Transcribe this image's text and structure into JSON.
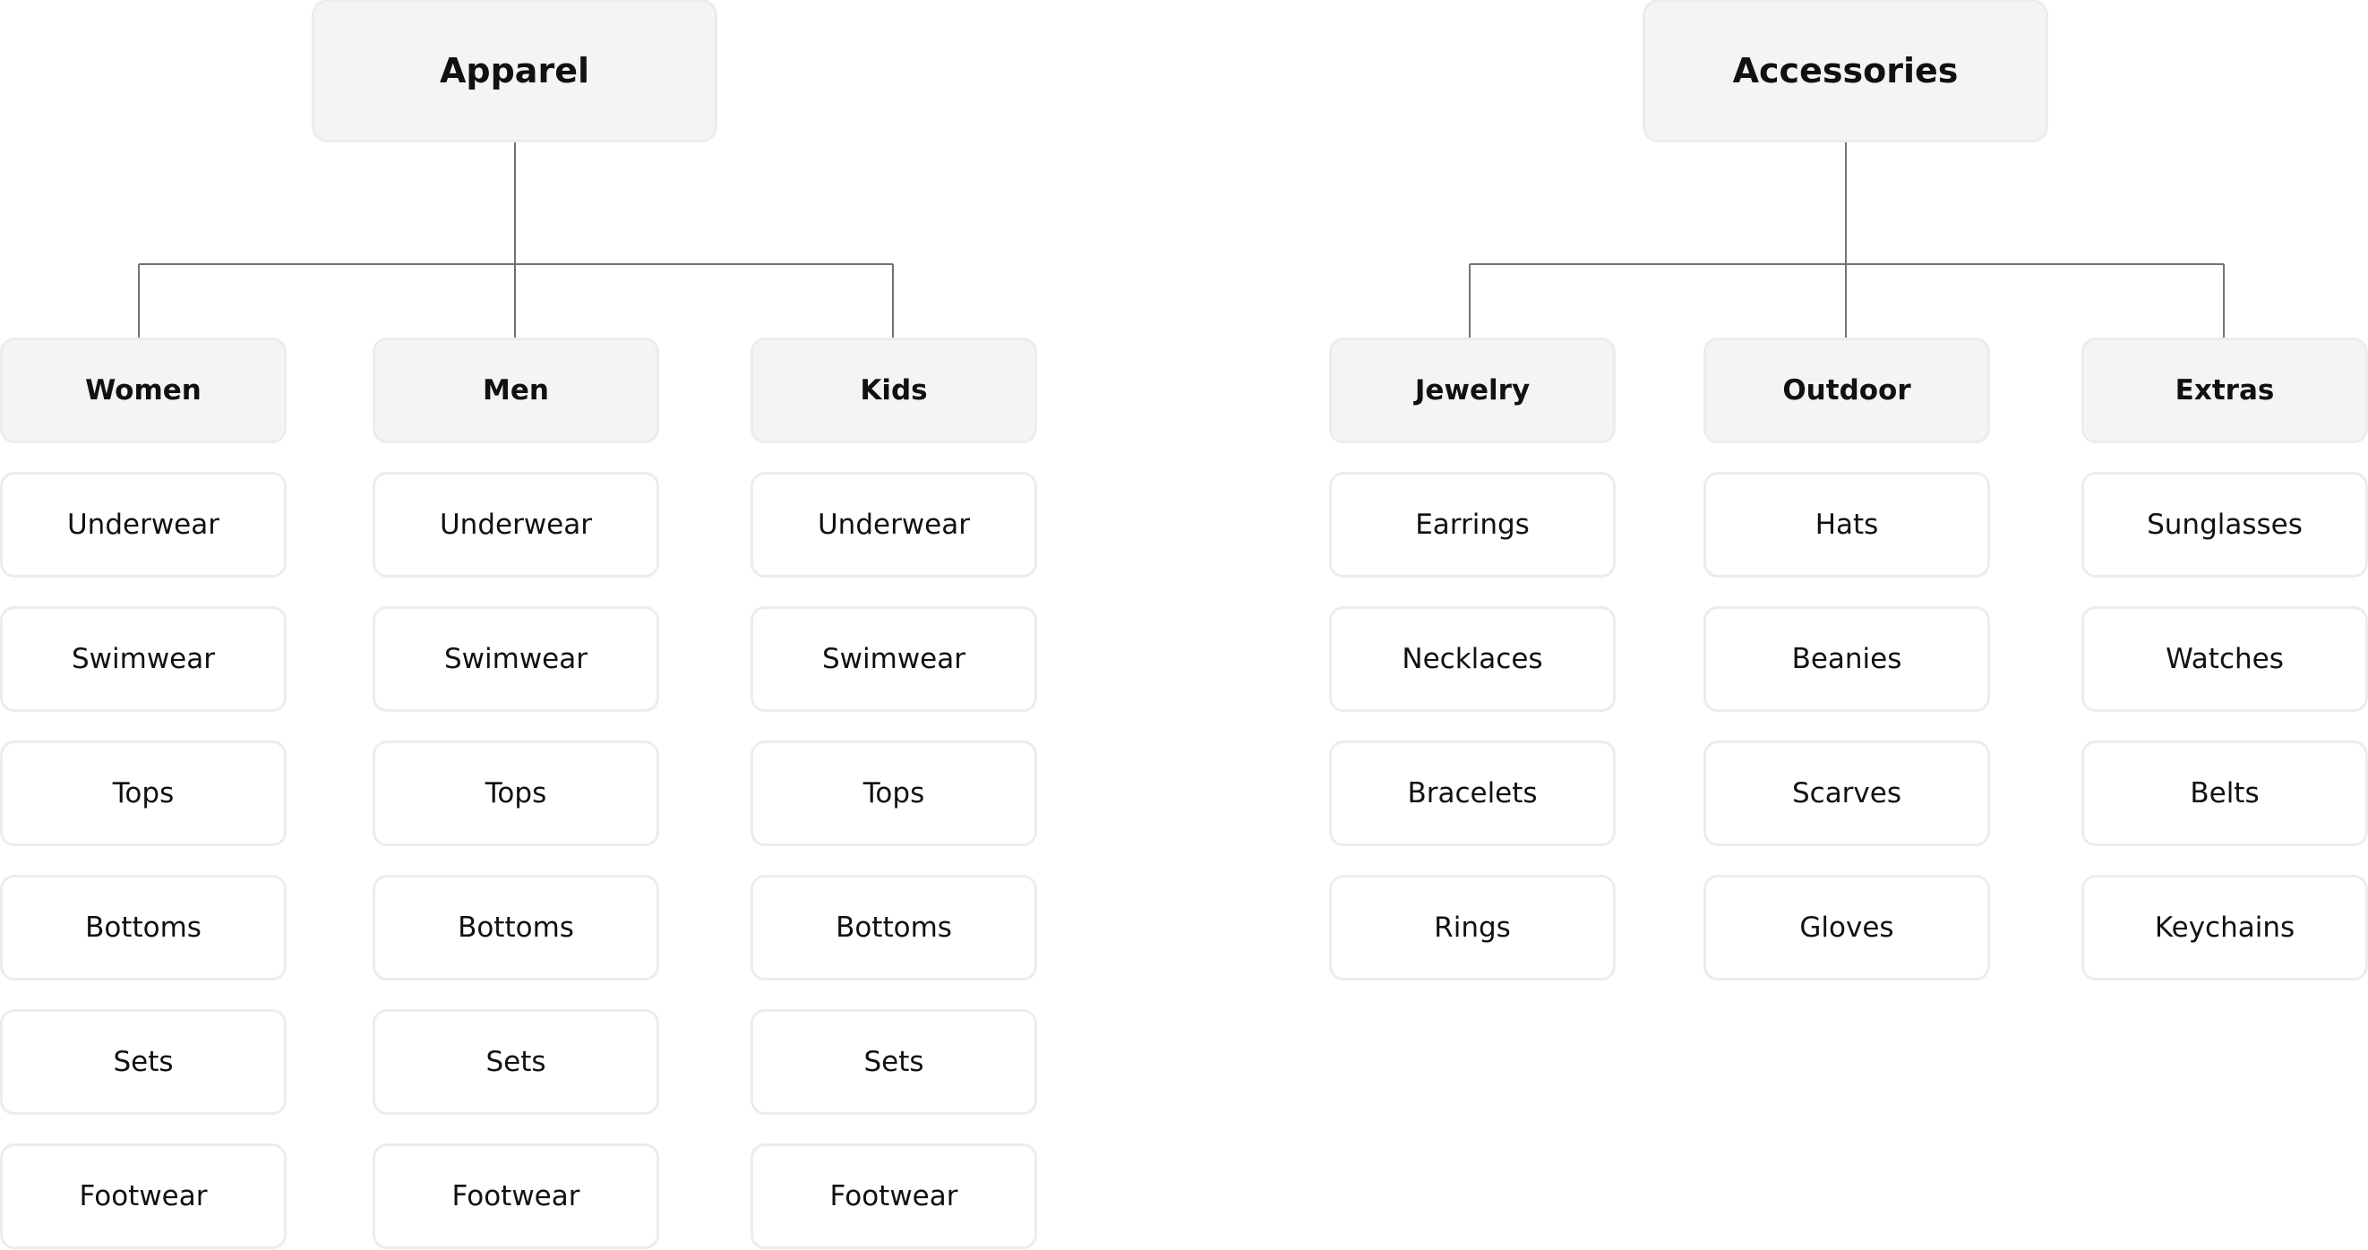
{
  "trees": [
    {
      "root": "Apparel",
      "groups": [
        {
          "label": "Women",
          "items": [
            "Underwear",
            "Swimwear",
            "Tops",
            "Bottoms",
            "Sets",
            "Footwear"
          ]
        },
        {
          "label": "Men",
          "items": [
            "Underwear",
            "Swimwear",
            "Tops",
            "Bottoms",
            "Sets",
            "Footwear"
          ]
        },
        {
          "label": "Kids",
          "items": [
            "Underwear",
            "Swimwear",
            "Tops",
            "Bottoms",
            "Sets",
            "Footwear"
          ]
        }
      ]
    },
    {
      "root": "Accessories",
      "groups": [
        {
          "label": "Jewelry",
          "items": [
            "Earrings",
            "Necklaces",
            "Bracelets",
            "Rings"
          ]
        },
        {
          "label": "Outdoor",
          "items": [
            "Hats",
            "Beanies",
            "Scarves",
            "Gloves"
          ]
        },
        {
          "label": "Extras",
          "items": [
            "Sunglasses",
            "Watches",
            "Belts",
            "Keychains"
          ]
        }
      ]
    }
  ],
  "colors": {
    "node_fill": "#f4f4f4",
    "leaf_fill": "#ffffff",
    "border": "#ebeded",
    "connector": "#6b7670"
  }
}
